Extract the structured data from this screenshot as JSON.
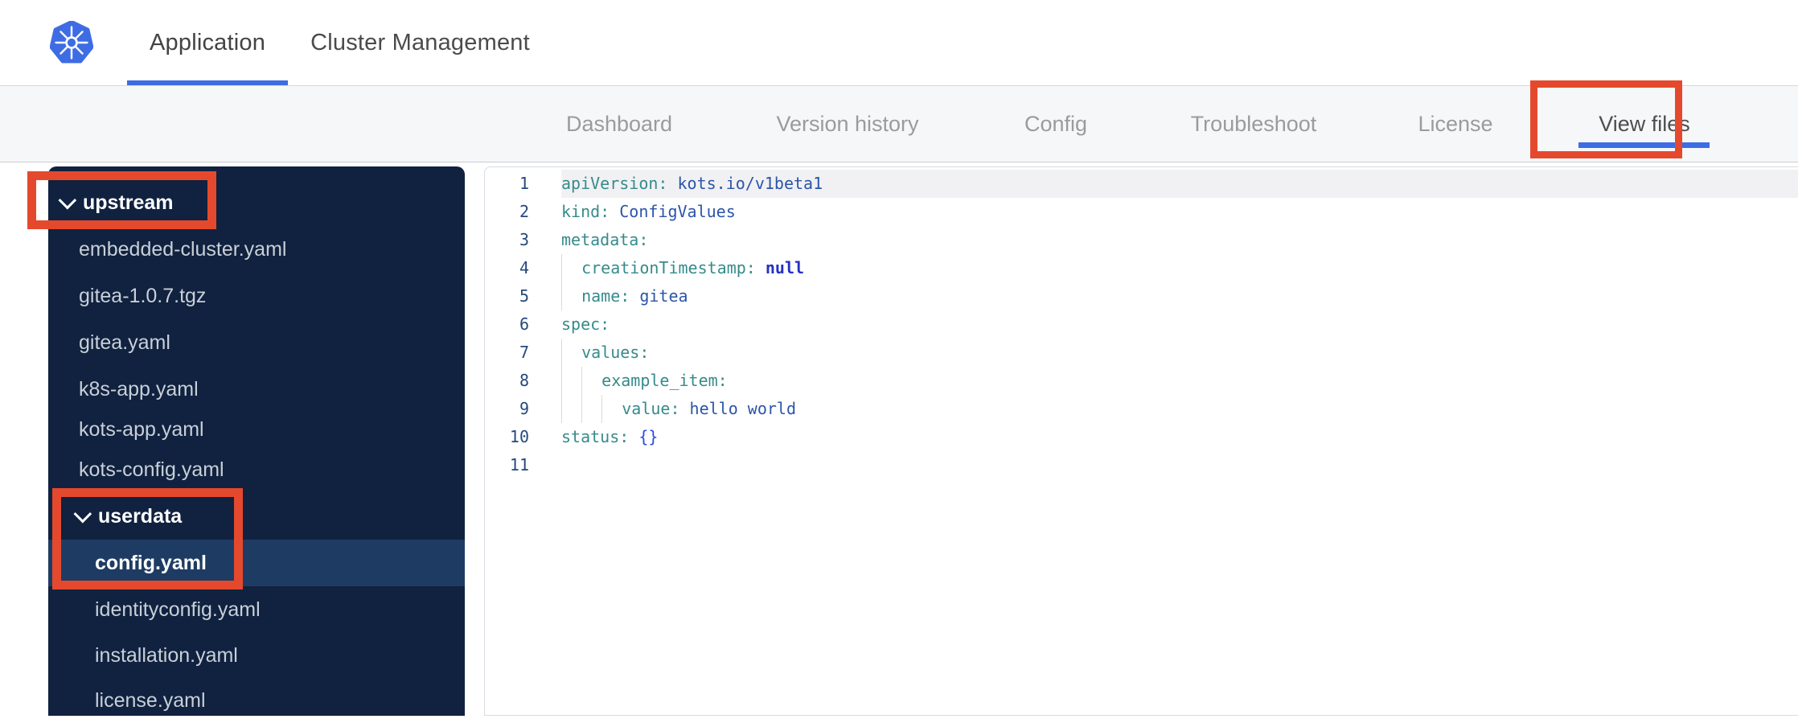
{
  "header": {
    "logo": "kubernetes-logo",
    "tabs": [
      {
        "label": "Application",
        "active": true
      },
      {
        "label": "Cluster Management",
        "active": false
      }
    ]
  },
  "subnav": {
    "items": [
      {
        "label": "Dashboard",
        "active": false
      },
      {
        "label": "Version history",
        "active": false
      },
      {
        "label": "Config",
        "active": false
      },
      {
        "label": "Troubleshoot",
        "active": false
      },
      {
        "label": "License",
        "active": false
      },
      {
        "label": "View files",
        "active": true
      }
    ]
  },
  "sidebar": {
    "tree": [
      {
        "type": "folder",
        "label": "upstream",
        "level": 0,
        "expanded": true
      },
      {
        "type": "file",
        "label": "embedded-cluster.yaml",
        "level": 1
      },
      {
        "type": "file",
        "label": "gitea-1.0.7.tgz",
        "level": 1
      },
      {
        "type": "file",
        "label": "gitea.yaml",
        "level": 1
      },
      {
        "type": "file",
        "label": "k8s-app.yaml",
        "level": 1
      },
      {
        "type": "file",
        "label": "kots-app.yaml",
        "level": 1,
        "row_variant": "short"
      },
      {
        "type": "file",
        "label": "kots-config.yaml",
        "level": 1
      },
      {
        "type": "folder",
        "label": "userdata",
        "level": 1,
        "expanded": true
      },
      {
        "type": "file",
        "label": "config.yaml",
        "level": 2,
        "selected": true
      },
      {
        "type": "file",
        "label": "identityconfig.yaml",
        "level": 2
      },
      {
        "type": "file",
        "label": "installation.yaml",
        "level": 2,
        "row_variant": "last"
      },
      {
        "type": "file",
        "label": "license.yaml",
        "level": 2,
        "row_variant": "last"
      }
    ]
  },
  "editor": {
    "language": "yaml",
    "lines": [
      {
        "num": "1",
        "indent": 0,
        "active": true,
        "tokens": [
          {
            "type": "key",
            "text": "apiVersion:"
          },
          {
            "type": "pln",
            "text": " "
          },
          {
            "type": "val",
            "text": "kots.io/v1beta1"
          }
        ]
      },
      {
        "num": "2",
        "indent": 0,
        "tokens": [
          {
            "type": "key",
            "text": "kind:"
          },
          {
            "type": "pln",
            "text": " "
          },
          {
            "type": "val",
            "text": "ConfigValues"
          }
        ]
      },
      {
        "num": "3",
        "indent": 0,
        "tokens": [
          {
            "type": "key",
            "text": "metadata:"
          }
        ]
      },
      {
        "num": "4",
        "indent": 1,
        "tokens": [
          {
            "type": "key",
            "text": "creationTimestamp:"
          },
          {
            "type": "pln",
            "text": " "
          },
          {
            "type": "null",
            "text": "null"
          }
        ]
      },
      {
        "num": "5",
        "indent": 1,
        "tokens": [
          {
            "type": "key",
            "text": "name:"
          },
          {
            "type": "pln",
            "text": " "
          },
          {
            "type": "val",
            "text": "gitea"
          }
        ]
      },
      {
        "num": "6",
        "indent": 0,
        "tokens": [
          {
            "type": "key",
            "text": "spec:"
          }
        ]
      },
      {
        "num": "7",
        "indent": 1,
        "tokens": [
          {
            "type": "key",
            "text": "values:"
          }
        ]
      },
      {
        "num": "8",
        "indent": 2,
        "tokens": [
          {
            "type": "key",
            "text": "example_item:"
          }
        ]
      },
      {
        "num": "9",
        "indent": 3,
        "tokens": [
          {
            "type": "key",
            "text": "value:"
          },
          {
            "type": "pln",
            "text": " "
          },
          {
            "type": "val",
            "text": "hello world"
          }
        ]
      },
      {
        "num": "10",
        "indent": 0,
        "tokens": [
          {
            "type": "key",
            "text": "status:"
          },
          {
            "type": "pln",
            "text": " "
          },
          {
            "type": "bracket",
            "text": "{}"
          }
        ]
      },
      {
        "num": "11",
        "indent": 0,
        "tokens": []
      }
    ]
  },
  "annotations": {
    "highlight_color": "#e5492d",
    "boxes": [
      {
        "target": "upstream folder"
      },
      {
        "target": "userdata folder and config.yaml file"
      },
      {
        "target": "View files tab"
      }
    ]
  },
  "colors": {
    "accent_blue": "#3c6de4",
    "sidebar_bg": "#10223f",
    "sidebar_selected_row": "#1e3c63",
    "subnav_bg": "#f6f7f8",
    "nav_inactive_text": "#9b9b9b",
    "nav_active_text": "#4e4e4e",
    "yaml_key": "#368b8b",
    "yaml_value": "#2b55a9",
    "yaml_null": "#2430c4",
    "yaml_bracket": "#2b4cdb",
    "line_number": "#25497c",
    "annotation_red": "#e5492d"
  }
}
